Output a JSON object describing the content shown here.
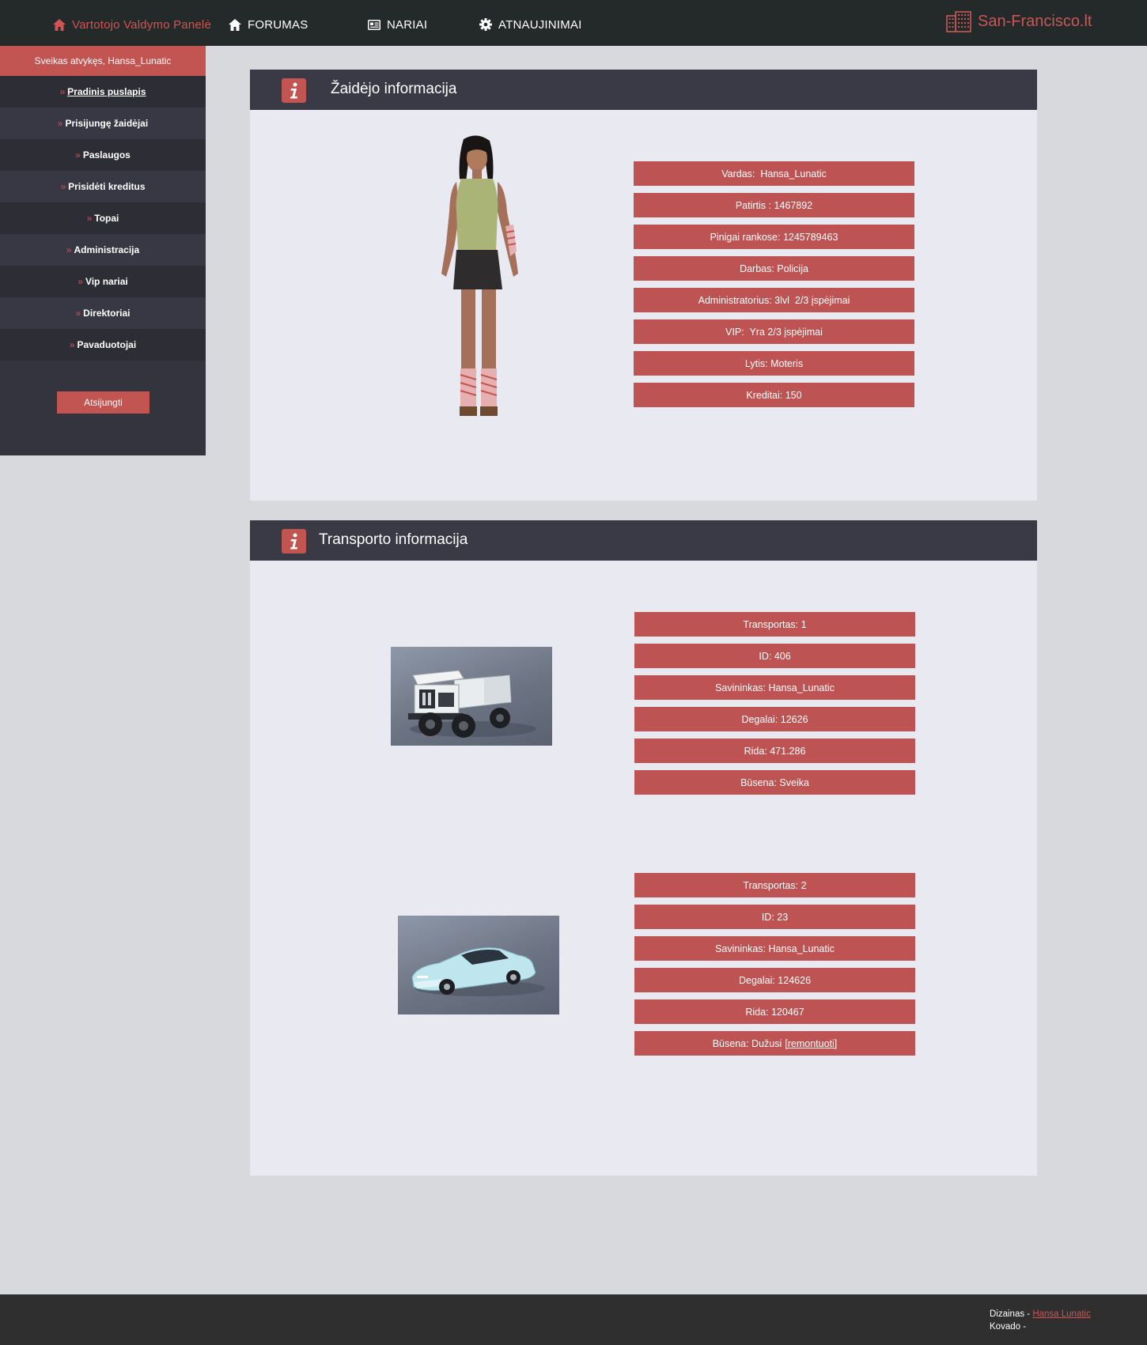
{
  "topbar": {
    "brand": "Vartotojo Valdymo Panelė",
    "forumas": "FORUMAS",
    "nariai": "NARIAI",
    "atnaujinimai": "ATNAUJINIMAI",
    "site": "San-Francisco.lt"
  },
  "sidebar": {
    "welcome": "Sveikas atvykęs, Hansa_Lunatic",
    "items": [
      {
        "label": "Pradinis puslapis"
      },
      {
        "label": "Prisijungę žaidėjai"
      },
      {
        "label": "Paslaugos"
      },
      {
        "label": "Prisidėti kreditus"
      },
      {
        "label": "Topai"
      },
      {
        "label": "Administracija"
      },
      {
        "label": "Vip nariai"
      },
      {
        "label": "Direktoriai"
      },
      {
        "label": "Pavaduotojai"
      }
    ],
    "raquo": "»",
    "logout": "Atsijungti"
  },
  "player_panel": {
    "title": "Žaidėjo informacija",
    "rows": [
      "Vardas:  Hansa_Lunatic",
      "Patirtis : 1467892",
      "Pinigai rankose: 1245789463",
      "Darbas: Policija",
      "Administratorius: 3lvl  2/3 įspėjimai",
      "VIP:  Yra 2/3 įspėjimai",
      "Lytis: Moteris",
      "Kreditai: 150"
    ]
  },
  "transport_panel": {
    "title": "Transporto informacija",
    "vehicle1": {
      "rows": [
        "Transportas: 1",
        "ID: 406",
        "Savininkas: Hansa_Lunatic",
        "Degalai: 12626",
        "Rida: 471.286",
        "Būsena: Sveika"
      ]
    },
    "vehicle2": {
      "rows": [
        "Transportas: 2",
        "ID: 23",
        "Savininkas: Hansa_Lunatic",
        "Degalai: 124626",
        "Rida: 120467"
      ],
      "status_text": "Būsena: Dužusi",
      "repair_link": "[remontuoti]"
    }
  },
  "footer": {
    "design_label": "Dizainas - ",
    "design_author": "Hansa Lunatic",
    "code_label": "Kovado -"
  },
  "colors": {
    "accent": "#c25452",
    "topbar": "#242929",
    "sidebar": "#34343f",
    "panel_header": "#393a45",
    "panel_body": "#e9e9f2",
    "page_bg": "#d8d9dc"
  },
  "icons": [
    "home-icon",
    "id-card-icon",
    "gear-icon",
    "building-icon",
    "info-icon"
  ]
}
